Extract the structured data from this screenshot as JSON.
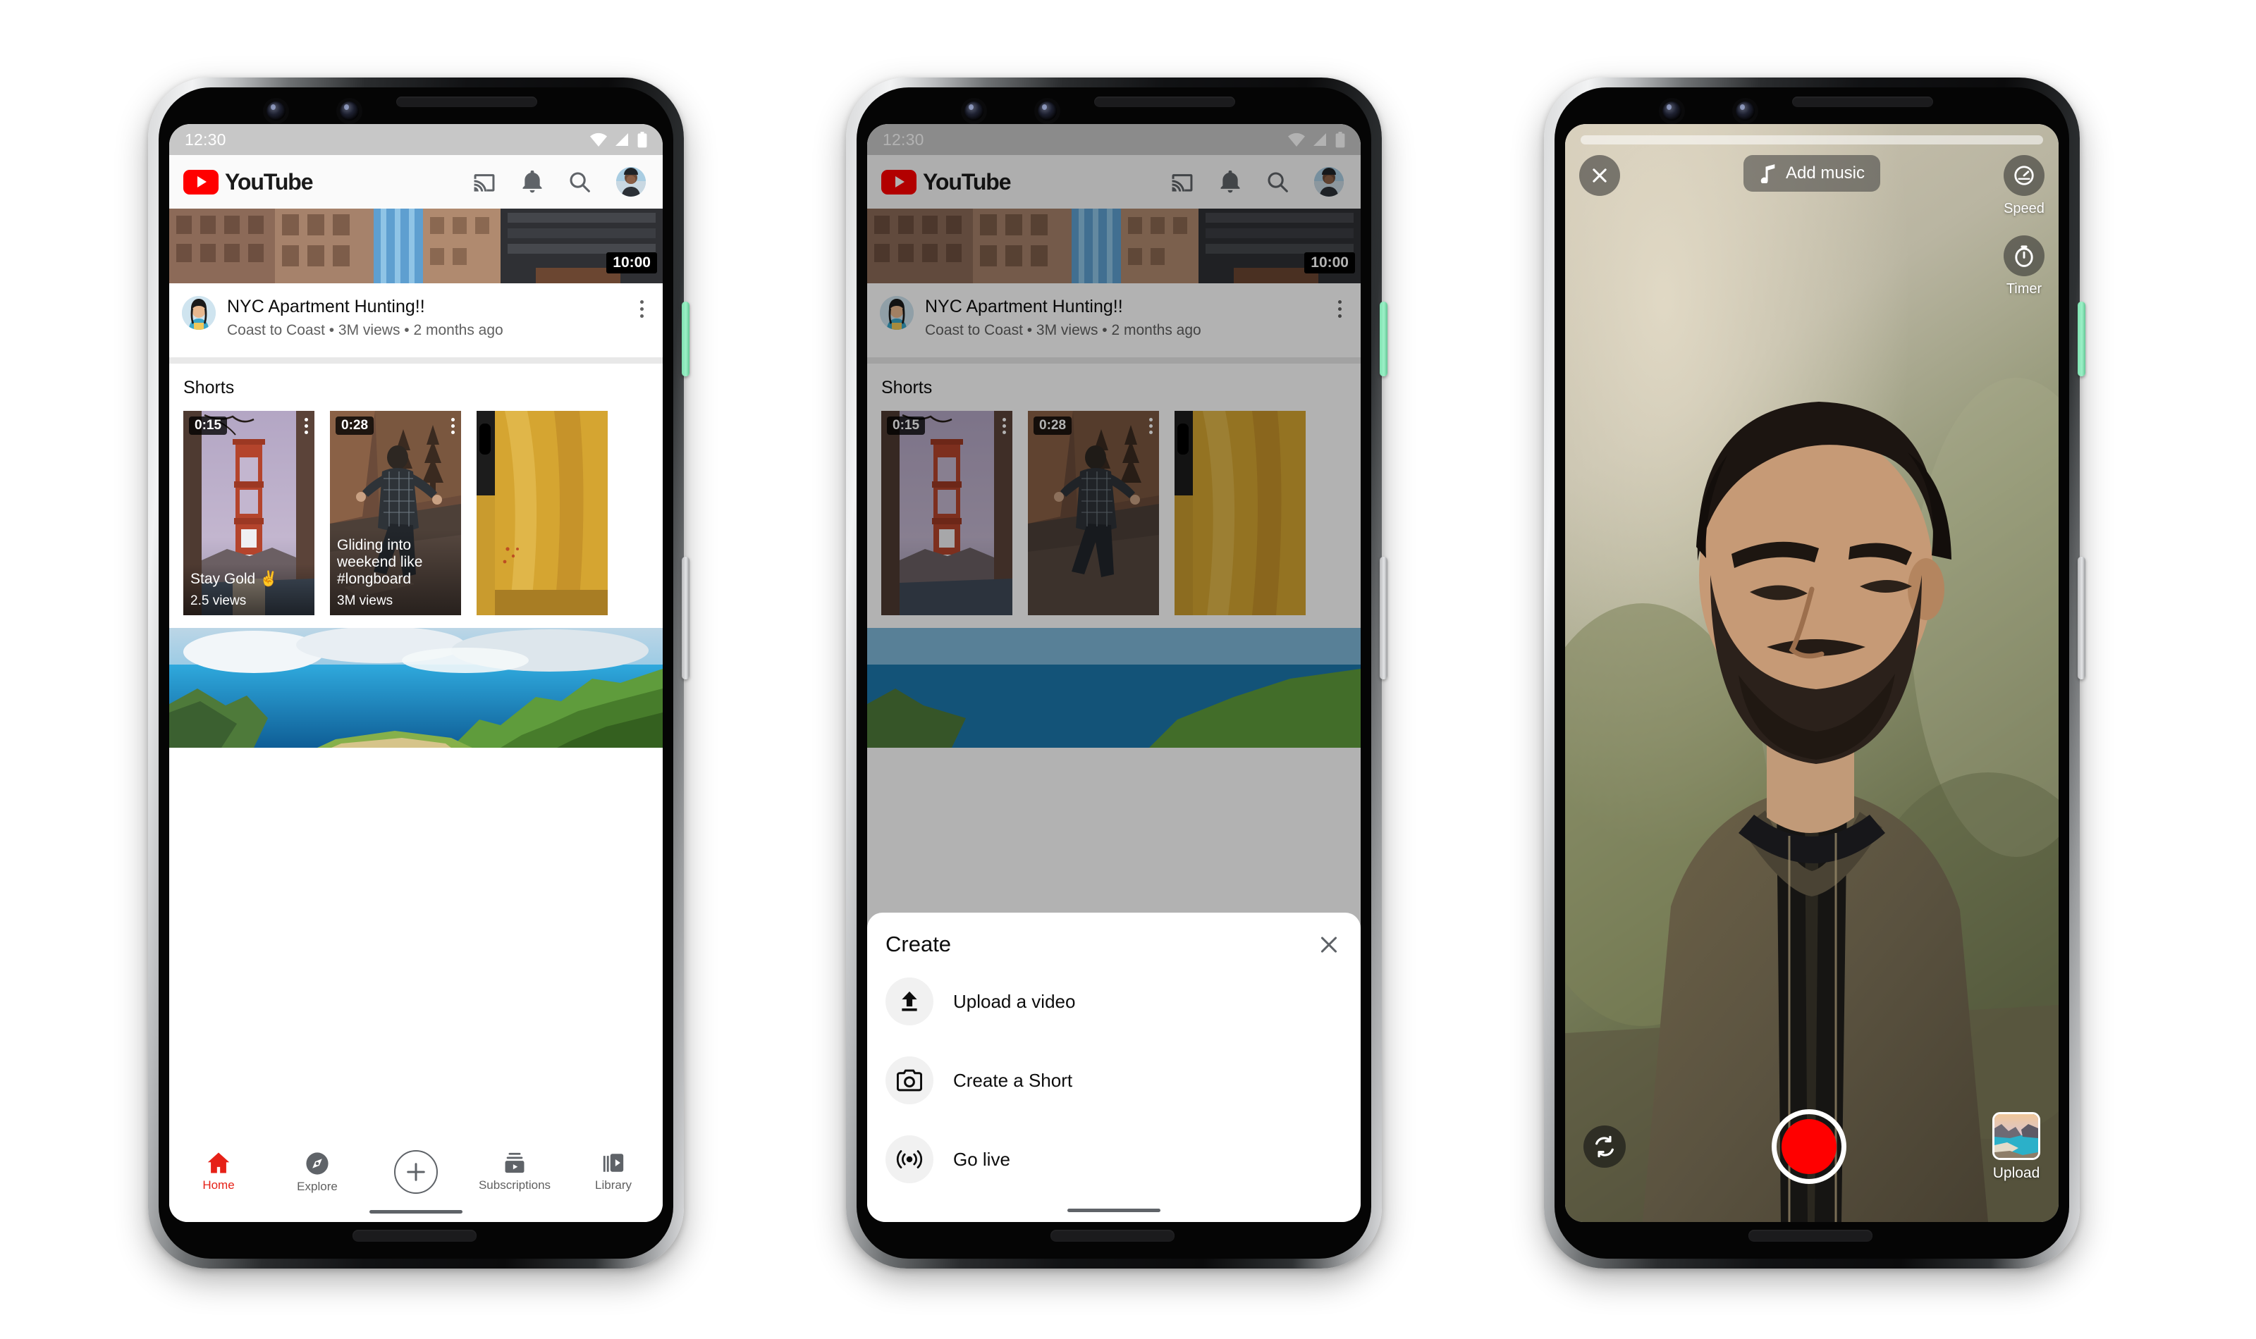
{
  "accent": {
    "youtube_red": "#ff0000",
    "nav_active": "#e62117",
    "power_button": "#7fe3b2"
  },
  "phones": [
    {
      "id": "phone-home",
      "status": {
        "time": "12:30",
        "icons": [
          "wifi-icon",
          "signal-icon",
          "battery-icon"
        ]
      },
      "header": {
        "logo_text": "YouTube",
        "icons": [
          "cast-icon",
          "notifications-bell-icon",
          "search-icon",
          "account-avatar"
        ]
      },
      "feed": {
        "featured_video": {
          "duration": "10:00",
          "title": "NYC Apartment Hunting!!",
          "meta": "Coast to Coast • 3M views • 2 months ago",
          "channel": "Coast to Coast",
          "views": "3M views",
          "age": "2 months ago"
        },
        "shorts_section_title": "Shorts",
        "shorts": [
          {
            "duration": "0:15",
            "title": "Stay Gold ✌️",
            "views": "2.5 views"
          },
          {
            "duration": "0:28",
            "title": "Gliding into weekend like #longboard",
            "views": "3M views"
          },
          {
            "duration": "",
            "title": "",
            "views": ""
          }
        ]
      },
      "bottom_nav": {
        "items": [
          {
            "label": "Home",
            "icon": "home-icon",
            "active": true
          },
          {
            "label": "Explore",
            "icon": "compass-icon",
            "active": false
          },
          {
            "label": "",
            "icon": "plus-create-icon",
            "active": false
          },
          {
            "label": "Subscriptions",
            "icon": "subscriptions-icon",
            "active": false
          },
          {
            "label": "Library",
            "icon": "library-icon",
            "active": false
          }
        ]
      }
    },
    {
      "id": "phone-create-sheet",
      "status": {
        "time": "12:30",
        "icons": [
          "wifi-icon",
          "signal-icon",
          "battery-icon"
        ]
      },
      "header": {
        "logo_text": "YouTube"
      },
      "feed": {
        "featured_video": {
          "duration": "10:00",
          "title": "NYC Apartment Hunting!!",
          "meta": "Coast to Coast • 3M views • 2 months ago"
        },
        "shorts_section_title": "Shorts",
        "shorts": [
          {
            "duration": "0:15"
          },
          {
            "duration": "0:28"
          },
          {
            "duration": ""
          }
        ]
      },
      "sheet": {
        "title": "Create",
        "close_icon": "close-icon",
        "items": [
          {
            "label": "Upload a video",
            "icon": "upload-arrow-icon"
          },
          {
            "label": "Create a Short",
            "icon": "camera-icon"
          },
          {
            "label": "Go live",
            "icon": "broadcast-live-icon"
          }
        ]
      }
    },
    {
      "id": "phone-shorts-camera",
      "top": {
        "close_icon": "close-icon",
        "add_music_label": "Add music",
        "music_icon": "music-note-icon"
      },
      "right_tools": [
        {
          "label": "Speed",
          "icon": "speedometer-icon"
        },
        {
          "label": "Timer",
          "icon": "stopwatch-icon"
        }
      ],
      "bottom": {
        "flip_icon": "flip-camera-icon",
        "record_button": "record-shutter-button",
        "upload_label": "Upload",
        "upload_icon": "gallery-thumbnail"
      }
    }
  ]
}
